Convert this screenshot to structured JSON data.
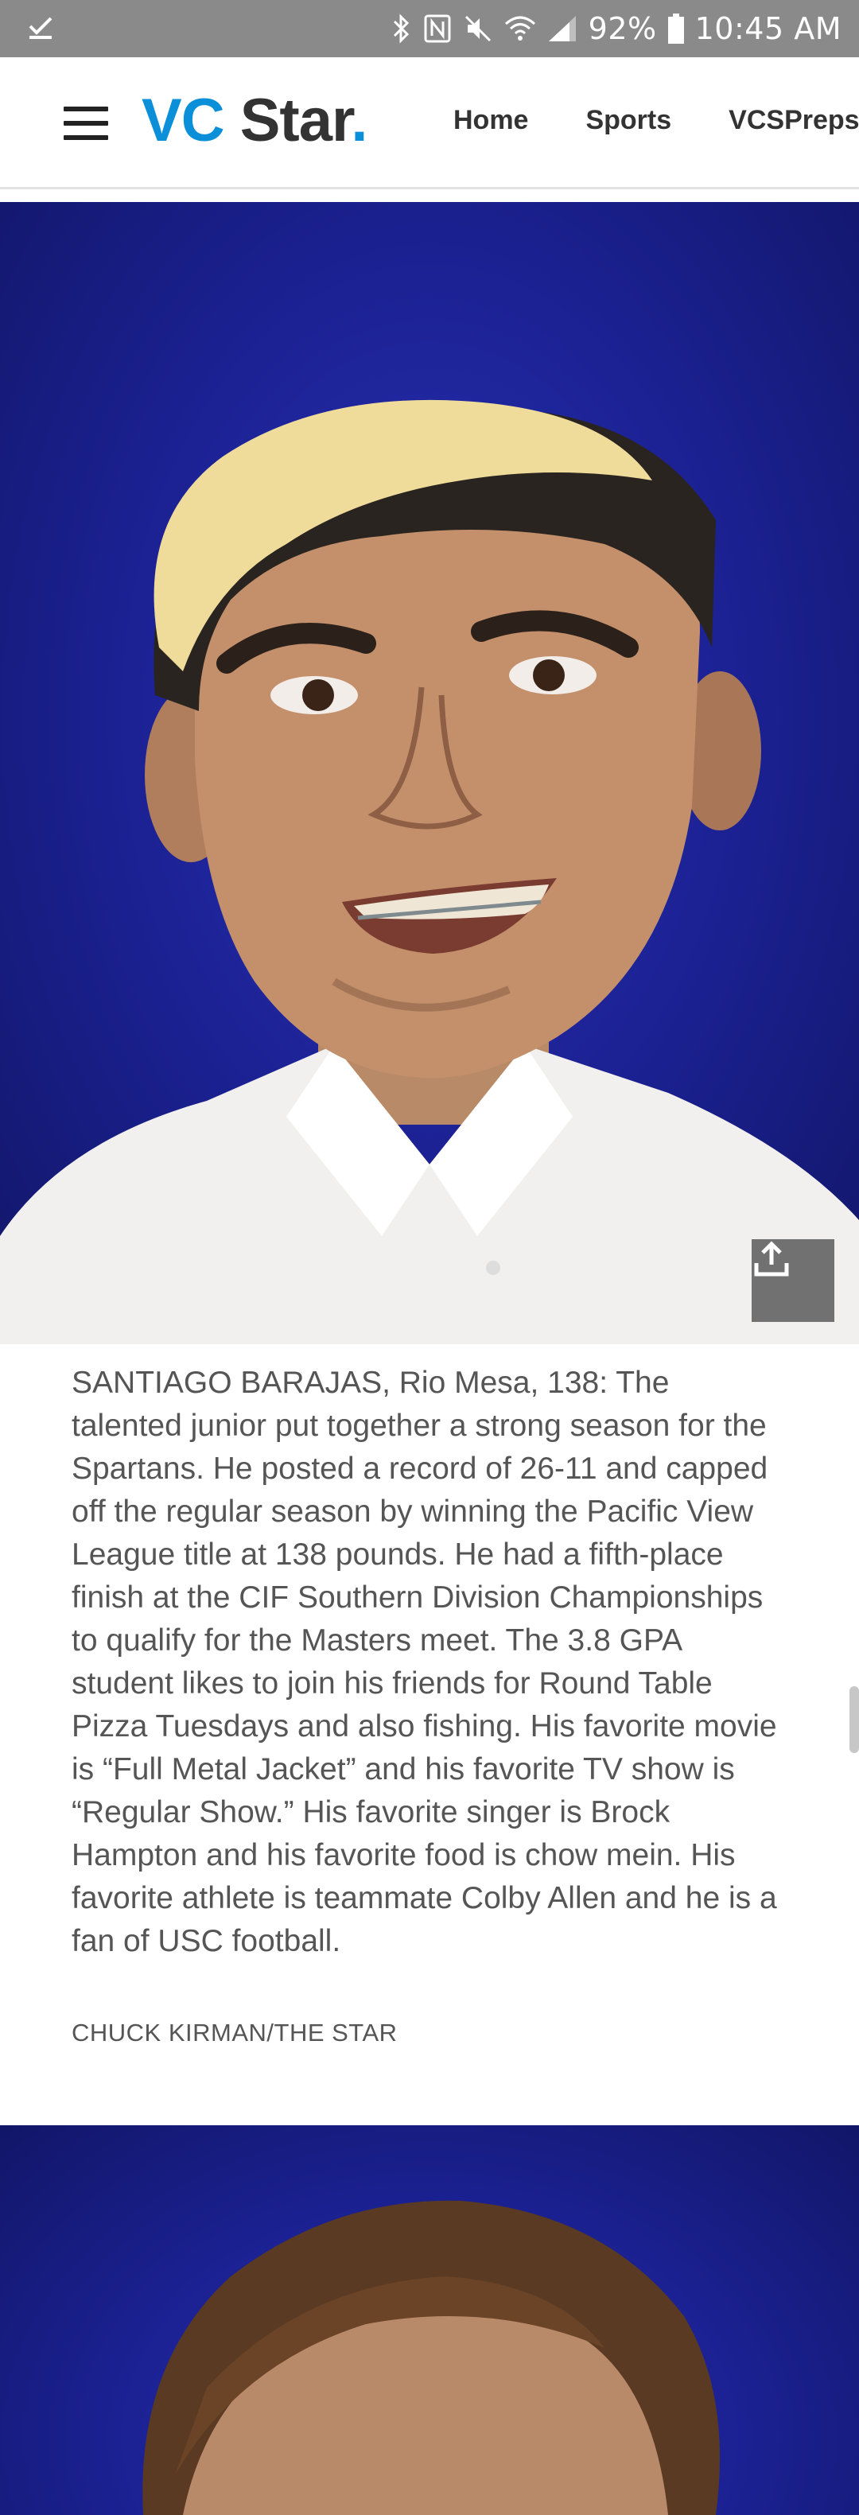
{
  "status_bar": {
    "battery": "92%",
    "time": "10:45 AM"
  },
  "header": {
    "logo_vc": "VC",
    "logo_star": "Star",
    "logo_dot": ".",
    "nav": [
      "Home",
      "Sports",
      "VCSPreps"
    ]
  },
  "article": {
    "caption": "SANTIAGO BARAJAS, Rio Mesa, 138: The talented junior put together a strong season for the Spartans. He posted a record of 26-11 and capped off the regular season by winning the Pacific View League title at 138 pounds. He had a fifth-place finish at the CIF Southern Division Championships to qualify for the Masters meet. The 3.8 GPA student likes to join his friends for Round Table Pizza Tuesdays and also fishing. His favorite movie is “Full Metal Jacket” and his favorite TV show is “Regular Show.” His favorite singer is Brock Hampton and his favorite food is chow mein. His favorite athlete is teammate Colby Allen and he is a fan of USC football.",
    "credit": "CHUCK KIRMAN/THE STAR"
  },
  "colors": {
    "brand_blue": "#0a8fd8",
    "photo_backdrop": "#1a208f"
  }
}
